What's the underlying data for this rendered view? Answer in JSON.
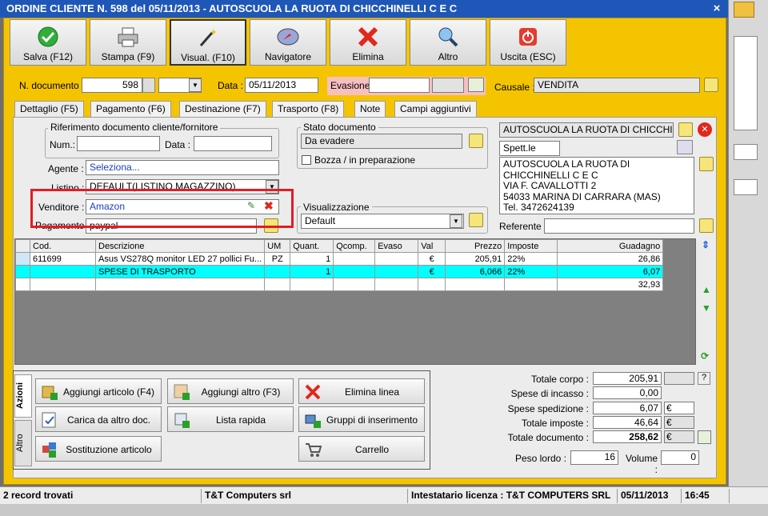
{
  "window": {
    "title": "ORDINE CLIENTE N. 598 del 05/11/2013 - AUTOSCUOLA LA RUOTA DI CHICCHINELLI C E C",
    "close": "×"
  },
  "toolbar": [
    {
      "label": "Salva (F12)",
      "icon": "check-icon"
    },
    {
      "label": "Stampa (F9)",
      "icon": "printer-icon"
    },
    {
      "label": "Visual. (F10)",
      "icon": "magic-wand-icon"
    },
    {
      "label": "Navigatore",
      "icon": "compass-icon"
    },
    {
      "label": "Elimina",
      "icon": "delete-x-icon"
    },
    {
      "label": "Altro",
      "icon": "magnifier-icon"
    },
    {
      "label": "Uscita (ESC)",
      "icon": "power-icon"
    }
  ],
  "header": {
    "ndoc_label": "N. documento :",
    "ndoc_value": "598",
    "data_label": "Data :",
    "data_value": "05/11/2013",
    "evasione_label": "Evasione:",
    "evasione_value": "",
    "causale_label": "Causale :",
    "causale_value": "VENDITA"
  },
  "tabs": [
    "Dettaglio (F5)",
    "Pagamento (F6)",
    "Destinazione (F7)",
    "Trasporto (F8)",
    "Note",
    "Campi aggiuntivi"
  ],
  "riferimento": {
    "title": "Riferimento documento cliente/fornitore",
    "num_label": "Num.:",
    "num_value": "",
    "data_label": "Data :",
    "data_value": ""
  },
  "agente": {
    "label": "Agente :",
    "value": "Seleziona..."
  },
  "listino": {
    "label": "Listino :",
    "value": "DEFAULT(LISTINO MAGAZZINO)"
  },
  "venditore": {
    "label": "Venditore :",
    "value": "Amazon"
  },
  "pagamento": {
    "label": "Pagamento :",
    "value": "paypal"
  },
  "stato": {
    "title": "Stato documento",
    "value": "Da evadere",
    "bozza": "Bozza / in preparazione"
  },
  "visualizzazione": {
    "title": "Visualizzazione",
    "value": "Default"
  },
  "cliente": {
    "name": "AUTOSCUOLA LA RUOTA DI CHICCHINELLI",
    "spett": "Spett.le",
    "address": [
      "AUTOSCUOLA LA RUOTA DI CHICCHINELLI C E C",
      "VIA F. CAVALLOTTI 2",
      "54033 MARINA DI CARRARA (MAS)",
      "Tel. 3472624139"
    ],
    "referente_label": "Referente",
    "referente_value": ""
  },
  "grid": {
    "columns": [
      "Cod.",
      "Descrizione",
      "UM",
      "Quant.",
      "Qcomp.",
      "Evaso",
      "Val",
      "Prezzo",
      "Imposte",
      "Guadagno"
    ],
    "rows": [
      {
        "cod": "611699",
        "desc": "Asus VS278Q monitor LED 27 pollici Fu...",
        "um": "PZ",
        "quant": "1",
        "qcomp": "",
        "evaso": "",
        "val": "€",
        "prezzo": "205,91",
        "imposte": "22%",
        "guadagno": "26,86"
      },
      {
        "cod": "",
        "desc": "SPESE DI TRASPORTO",
        "um": "",
        "quant": "1",
        "qcomp": "",
        "evaso": "",
        "val": "€",
        "prezzo": "6,066",
        "imposte": "22%",
        "guadagno": "6,07"
      }
    ],
    "total_guadagno": "32,93"
  },
  "side_tabs": [
    "Azioni",
    "Altro"
  ],
  "actions": [
    {
      "label": "Aggiungi articolo (F4)",
      "icon": "add-box-icon"
    },
    {
      "label": "Aggiungi altro (F3)",
      "icon": "add-table-icon"
    },
    {
      "label": "Elimina linea",
      "icon": "delete-x-icon"
    },
    {
      "label": "Carica da altro doc.",
      "icon": "load-doc-icon"
    },
    {
      "label": "Lista rapida",
      "icon": "quick-list-icon"
    },
    {
      "label": "Gruppi di inserimento",
      "icon": "groups-icon"
    },
    {
      "label": "Sostituzione articolo",
      "icon": "replace-icon"
    },
    {
      "label": "",
      "icon": ""
    },
    {
      "label": "Carrello",
      "icon": "cart-icon"
    }
  ],
  "totals": {
    "corpo_label": "Totale corpo :",
    "corpo": "205,91",
    "incasso_label": "Spese di incasso :",
    "incasso": "0,00",
    "spedizione_label": "Spese spedizione :",
    "spedizione": "6,07",
    "imposte_label": "Totale imposte :",
    "imposte": "46,64",
    "documento_label": "Totale documento :",
    "documento": "258,62",
    "currency": "€",
    "help": "?",
    "peso_label": "Peso lordo :",
    "peso": "16",
    "volume_label": "Volume :",
    "volume": "0"
  },
  "status": {
    "records": "2 record trovati",
    "company": "T&T Computers srl",
    "licenza": "Intestatario licenza : T&T COMPUTERS SRL",
    "date": "05/11/2013",
    "time": "16:45"
  },
  "colors": {
    "accent": "#f5c400",
    "title": "#1f57b8",
    "highlight": "#e51b24",
    "selected_row": "#00ffff"
  }
}
